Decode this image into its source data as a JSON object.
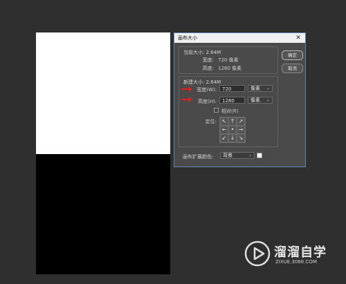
{
  "dialog": {
    "title": "画布大小",
    "ok_label": "确定",
    "cancel_label": "取消",
    "current": {
      "title": "当前大小: 2.64M",
      "width_label": "宽度:",
      "width_value": "720 像素",
      "height_label": "高度:",
      "height_value": "1280 像素"
    },
    "new_size": {
      "title": "新建大小: 2.64M",
      "width_label": "宽度(W):",
      "width_value": "720",
      "width_unit": "像素",
      "height_label": "高度(H):",
      "height_value": "1280",
      "height_unit": "像素",
      "relative_label": "相对(R)",
      "anchor_label": "定位:"
    },
    "extension": {
      "label": "画布扩展颜色:",
      "value": "背景",
      "swatch_color": "#ffffff"
    }
  },
  "watermark": {
    "name": "溜溜自学",
    "url": "ZIXUE.3066.COM"
  },
  "colors": {
    "accent_border": "#5e86b9",
    "arrow": "#dd2222"
  }
}
